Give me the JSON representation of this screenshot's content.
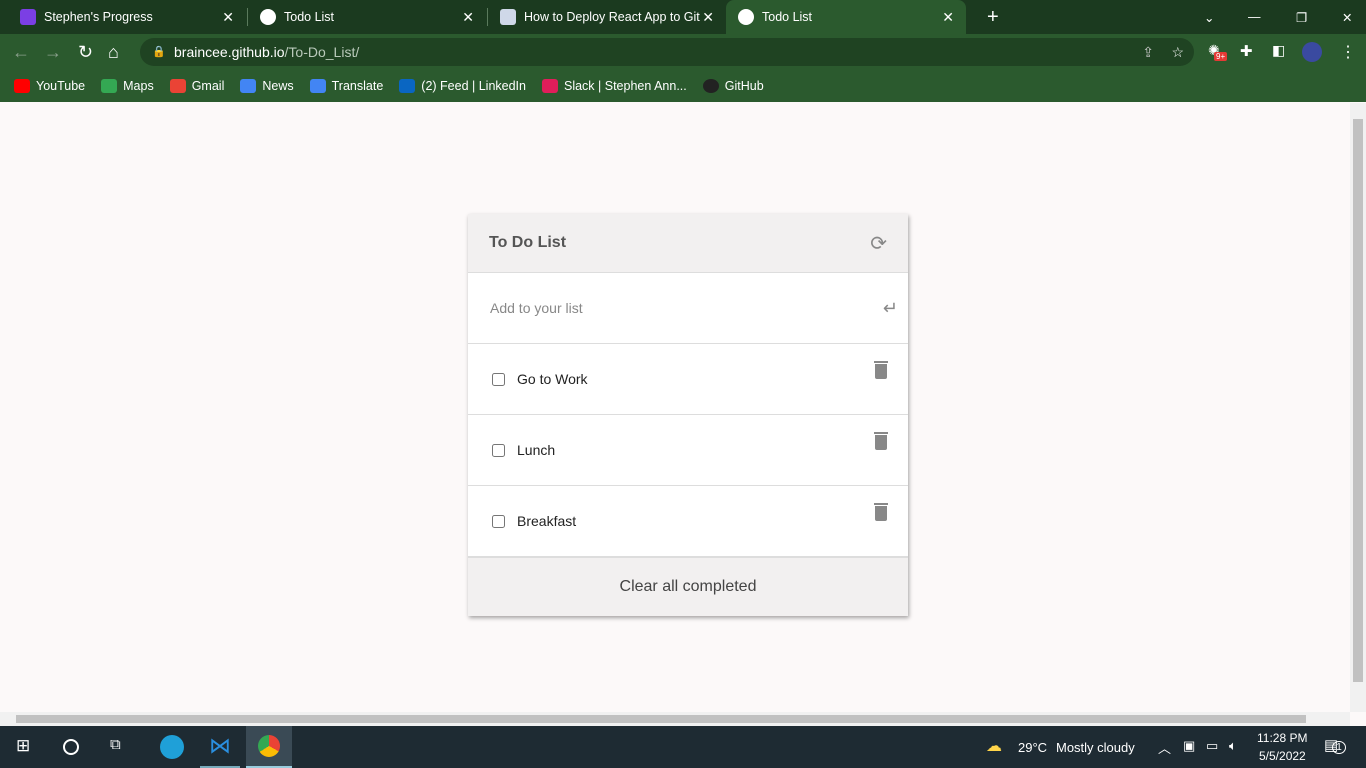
{
  "tabs": [
    {
      "label": "Stephen's Progress"
    },
    {
      "label": "Todo List"
    },
    {
      "label": "How to Deploy React App to Gith"
    },
    {
      "label": "Todo List",
      "active": true
    }
  ],
  "address": {
    "host": "braincee.github.io",
    "path": "/To-Do_List/"
  },
  "bookmarks": [
    {
      "label": "YouTube",
      "color": "#ff0000"
    },
    {
      "label": "Maps",
      "color": "#34a853"
    },
    {
      "label": "Gmail",
      "color": "#ea4335"
    },
    {
      "label": "News",
      "color": "#4285f4"
    },
    {
      "label": "Translate",
      "color": "#4285f4"
    },
    {
      "label": "(2) Feed | LinkedIn",
      "color": "#0a66c2"
    },
    {
      "label": "Slack | Stephen Ann...",
      "color": "#e01e5a"
    },
    {
      "label": "GitHub",
      "color": "#222222"
    }
  ],
  "extension_badge": "9+",
  "todo": {
    "title": "To Do List",
    "placeholder": "Add to your list",
    "items": [
      {
        "label": "Go to Work",
        "done": false
      },
      {
        "label": "Lunch",
        "done": false
      },
      {
        "label": "Breakfast",
        "done": false
      }
    ],
    "clear_label": "Clear all completed"
  },
  "taskbar": {
    "weather": "29°C",
    "condition": "Mostly cloudy",
    "time": "11:28 PM",
    "date": "5/5/2022",
    "notifications": "1"
  }
}
